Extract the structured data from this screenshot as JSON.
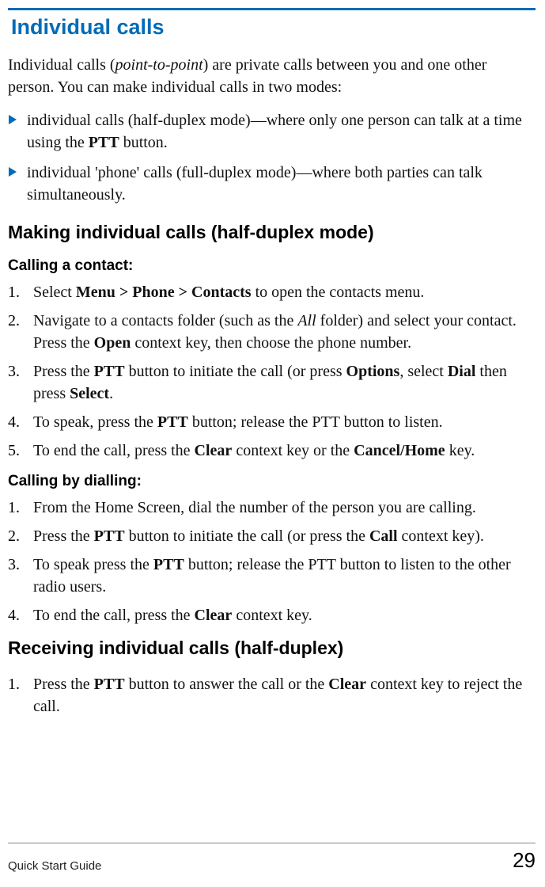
{
  "colors": {
    "accent": "#006bb6"
  },
  "title": "Individual calls",
  "intro_parts": [
    "Individual calls (",
    "point-to-point",
    ") are private calls between you and one other person. You can make individual calls in two modes:"
  ],
  "bullets": [
    {
      "parts": [
        "individual calls (half-duplex mode)—where only one person can talk at a time using the ",
        "PTT",
        " button."
      ]
    },
    {
      "parts": [
        "individual 'phone' calls (full-duplex mode)—where both parties can talk simultaneously."
      ]
    }
  ],
  "section_making": "Making individual calls (half-duplex mode)",
  "calling_contact_heading": "Calling a contact:",
  "calling_contact_steps": [
    {
      "num": "1.",
      "parts": [
        "Select ",
        "Menu > Phone > Contacts",
        " to open the contacts menu."
      ]
    },
    {
      "num": "2.",
      "parts": [
        "Navigate to a contacts folder (such as the ",
        "All",
        " folder) and select your contact. Press the ",
        "Open",
        " context key, then choose the phone number."
      ]
    },
    {
      "num": "3.",
      "parts": [
        "Press the ",
        "PTT",
        " button to initiate the call (or press ",
        "Options",
        ", select ",
        "Dial",
        " then press ",
        "Select",
        "."
      ]
    },
    {
      "num": "4.",
      "parts": [
        "To speak, press the ",
        "PTT",
        " button; release the PTT button to listen."
      ]
    },
    {
      "num": "5.",
      "parts": [
        "To end the call, press the ",
        "Clear",
        " context key or the ",
        "Cancel/Home",
        " key."
      ]
    }
  ],
  "calling_dial_heading": "Calling by dialling:",
  "calling_dial_steps": [
    {
      "num": "1.",
      "parts": [
        "From the Home Screen, dial the number of the person you are calling."
      ]
    },
    {
      "num": "2.",
      "parts": [
        "Press the ",
        "PTT",
        " button to initiate the call (or press the ",
        "Call",
        " context key)."
      ]
    },
    {
      "num": "3.",
      "parts": [
        "To speak press the ",
        "PTT",
        " button; release the PTT button to listen to the other radio users."
      ]
    },
    {
      "num": "4.",
      "parts": [
        "To end the call, press the ",
        "Clear",
        " context key."
      ]
    }
  ],
  "section_receiving": "Receiving individual calls (half-duplex)",
  "receiving_steps": [
    {
      "num": "1.",
      "parts": [
        "Press the ",
        "PTT",
        " button to answer the call or the ",
        "Clear",
        " context key to reject the call."
      ]
    }
  ],
  "footer": {
    "guide": "Quick Start Guide",
    "page": "29"
  }
}
